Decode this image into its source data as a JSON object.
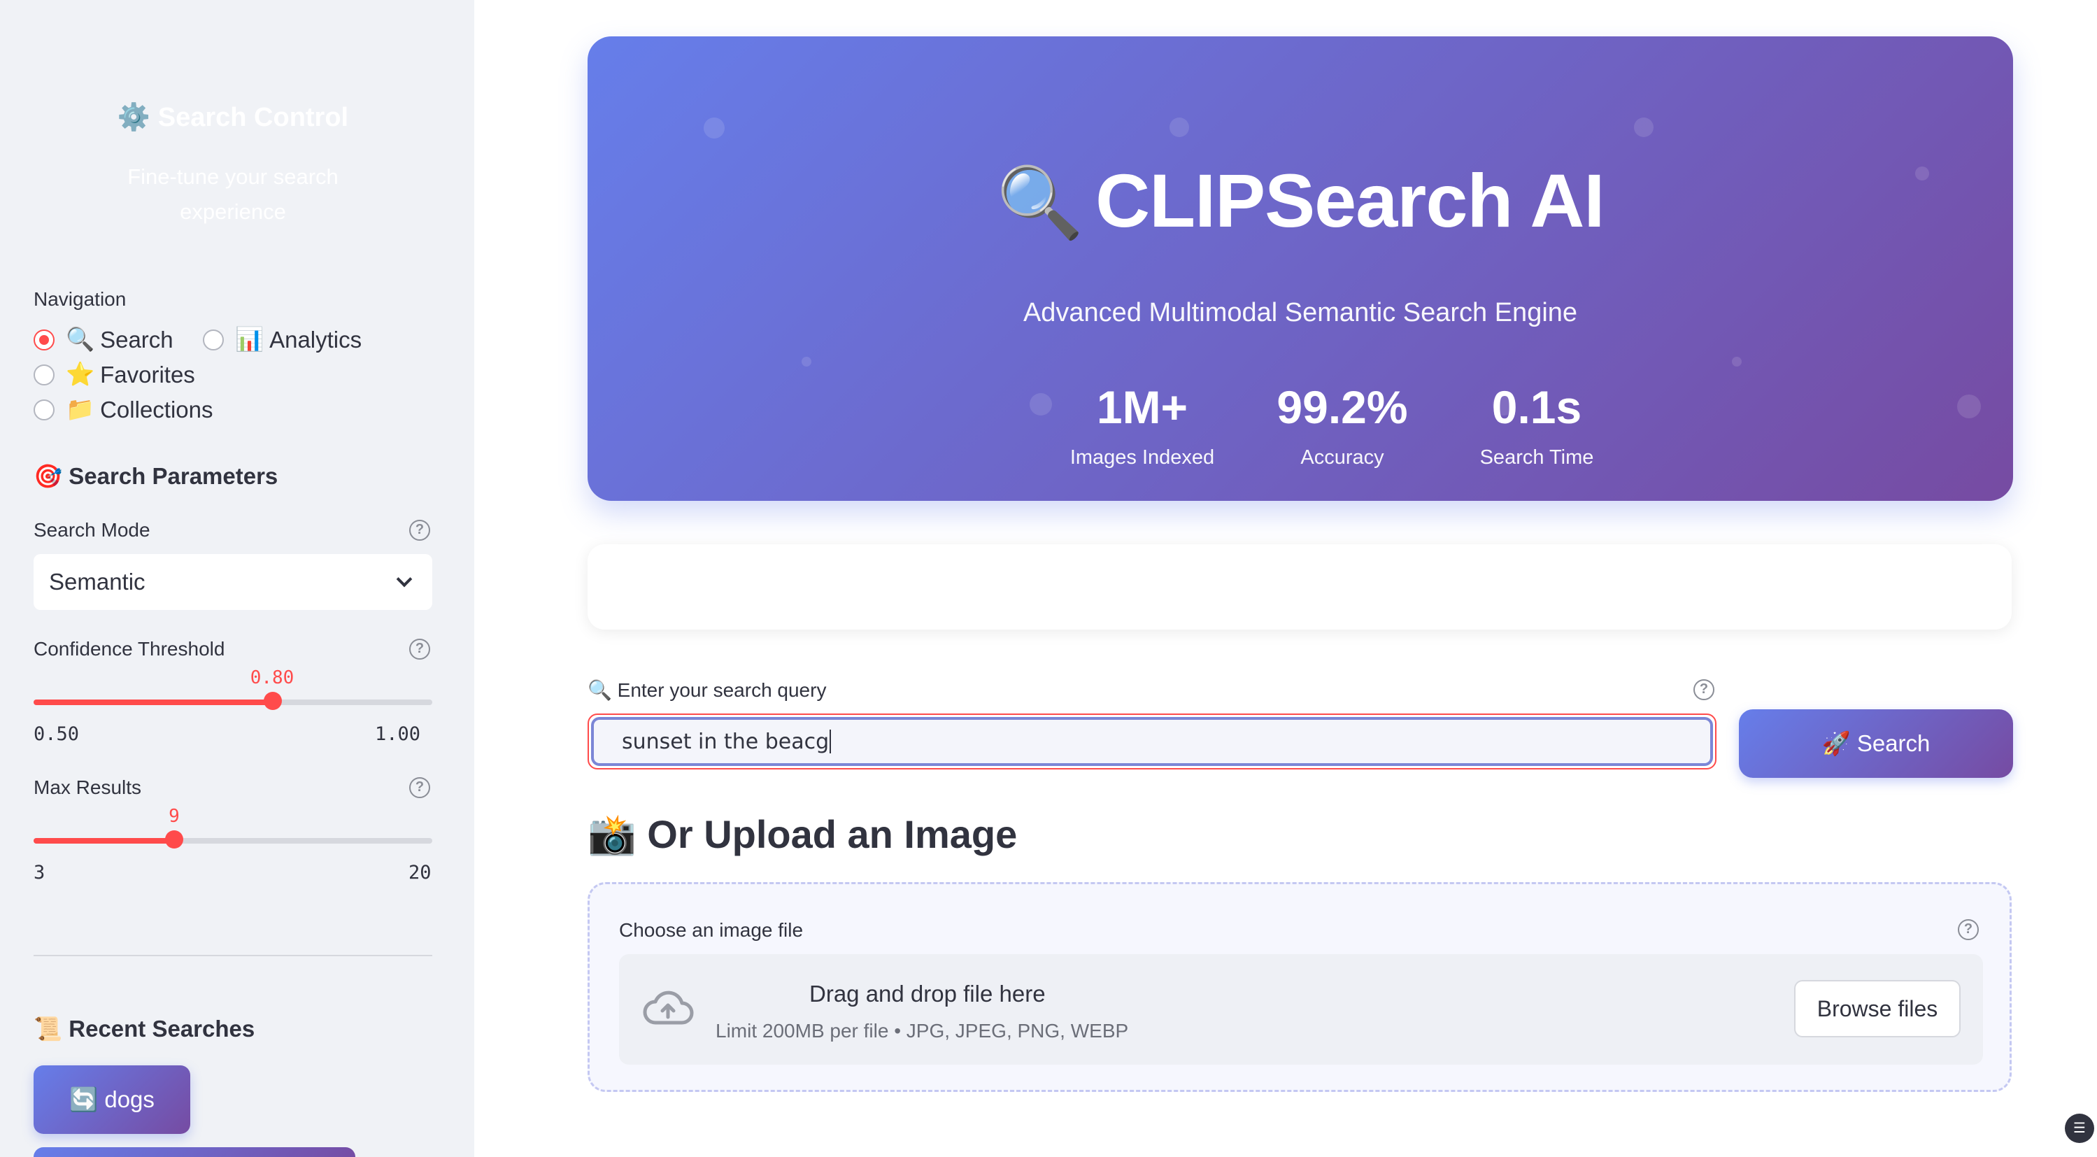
{
  "sidebar": {
    "title_icon": "gear-icon",
    "title": "⚙️ Search Control",
    "subtitle": "Fine-tune your search experience",
    "navigation": {
      "label": "Navigation",
      "options": [
        {
          "icon": "🔍",
          "label": "Search",
          "selected": true
        },
        {
          "icon": "📊",
          "label": "Analytics",
          "selected": false
        },
        {
          "icon": "⭐",
          "label": "Favorites",
          "selected": false
        },
        {
          "icon": "📁",
          "label": "Collections",
          "selected": false
        }
      ]
    },
    "params_heading": "🎯 Search Parameters",
    "search_mode": {
      "label": "Search Mode",
      "value": "Semantic"
    },
    "confidence": {
      "label": "Confidence Threshold",
      "value": "0.80",
      "min": "0.50",
      "max": "1.00",
      "fraction": 0.6
    },
    "max_results": {
      "label": "Max Results",
      "value": "9",
      "min": "3",
      "max": "20",
      "fraction": 0.353
    },
    "recent_heading": "📜 Recent Searches",
    "recent_items": [
      "🔄 dogs"
    ]
  },
  "hero": {
    "icon": "🔍",
    "title": "CLIPSearch AI",
    "subtitle": "Advanced Multimodal Semantic Search Engine",
    "stats": [
      {
        "value": "1M+",
        "label": "Images Indexed"
      },
      {
        "value": "99.2%",
        "label": "Accuracy"
      },
      {
        "value": "0.1s",
        "label": "Search Time"
      }
    ]
  },
  "search": {
    "label": "🔍 Enter your search query",
    "value": "sunset in the beacg",
    "button": "🚀 Search"
  },
  "upload": {
    "heading": "📸 Or Upload an Image",
    "label": "Choose an image file",
    "drop_title": "Drag and drop file here",
    "drop_sub": "Limit 200MB per file • JPG, JPEG, PNG, WEBP",
    "browse": "Browse files"
  },
  "colors": {
    "accent": "#ff4b4b",
    "gradient_start": "#667eea",
    "gradient_end": "#764ba2"
  }
}
